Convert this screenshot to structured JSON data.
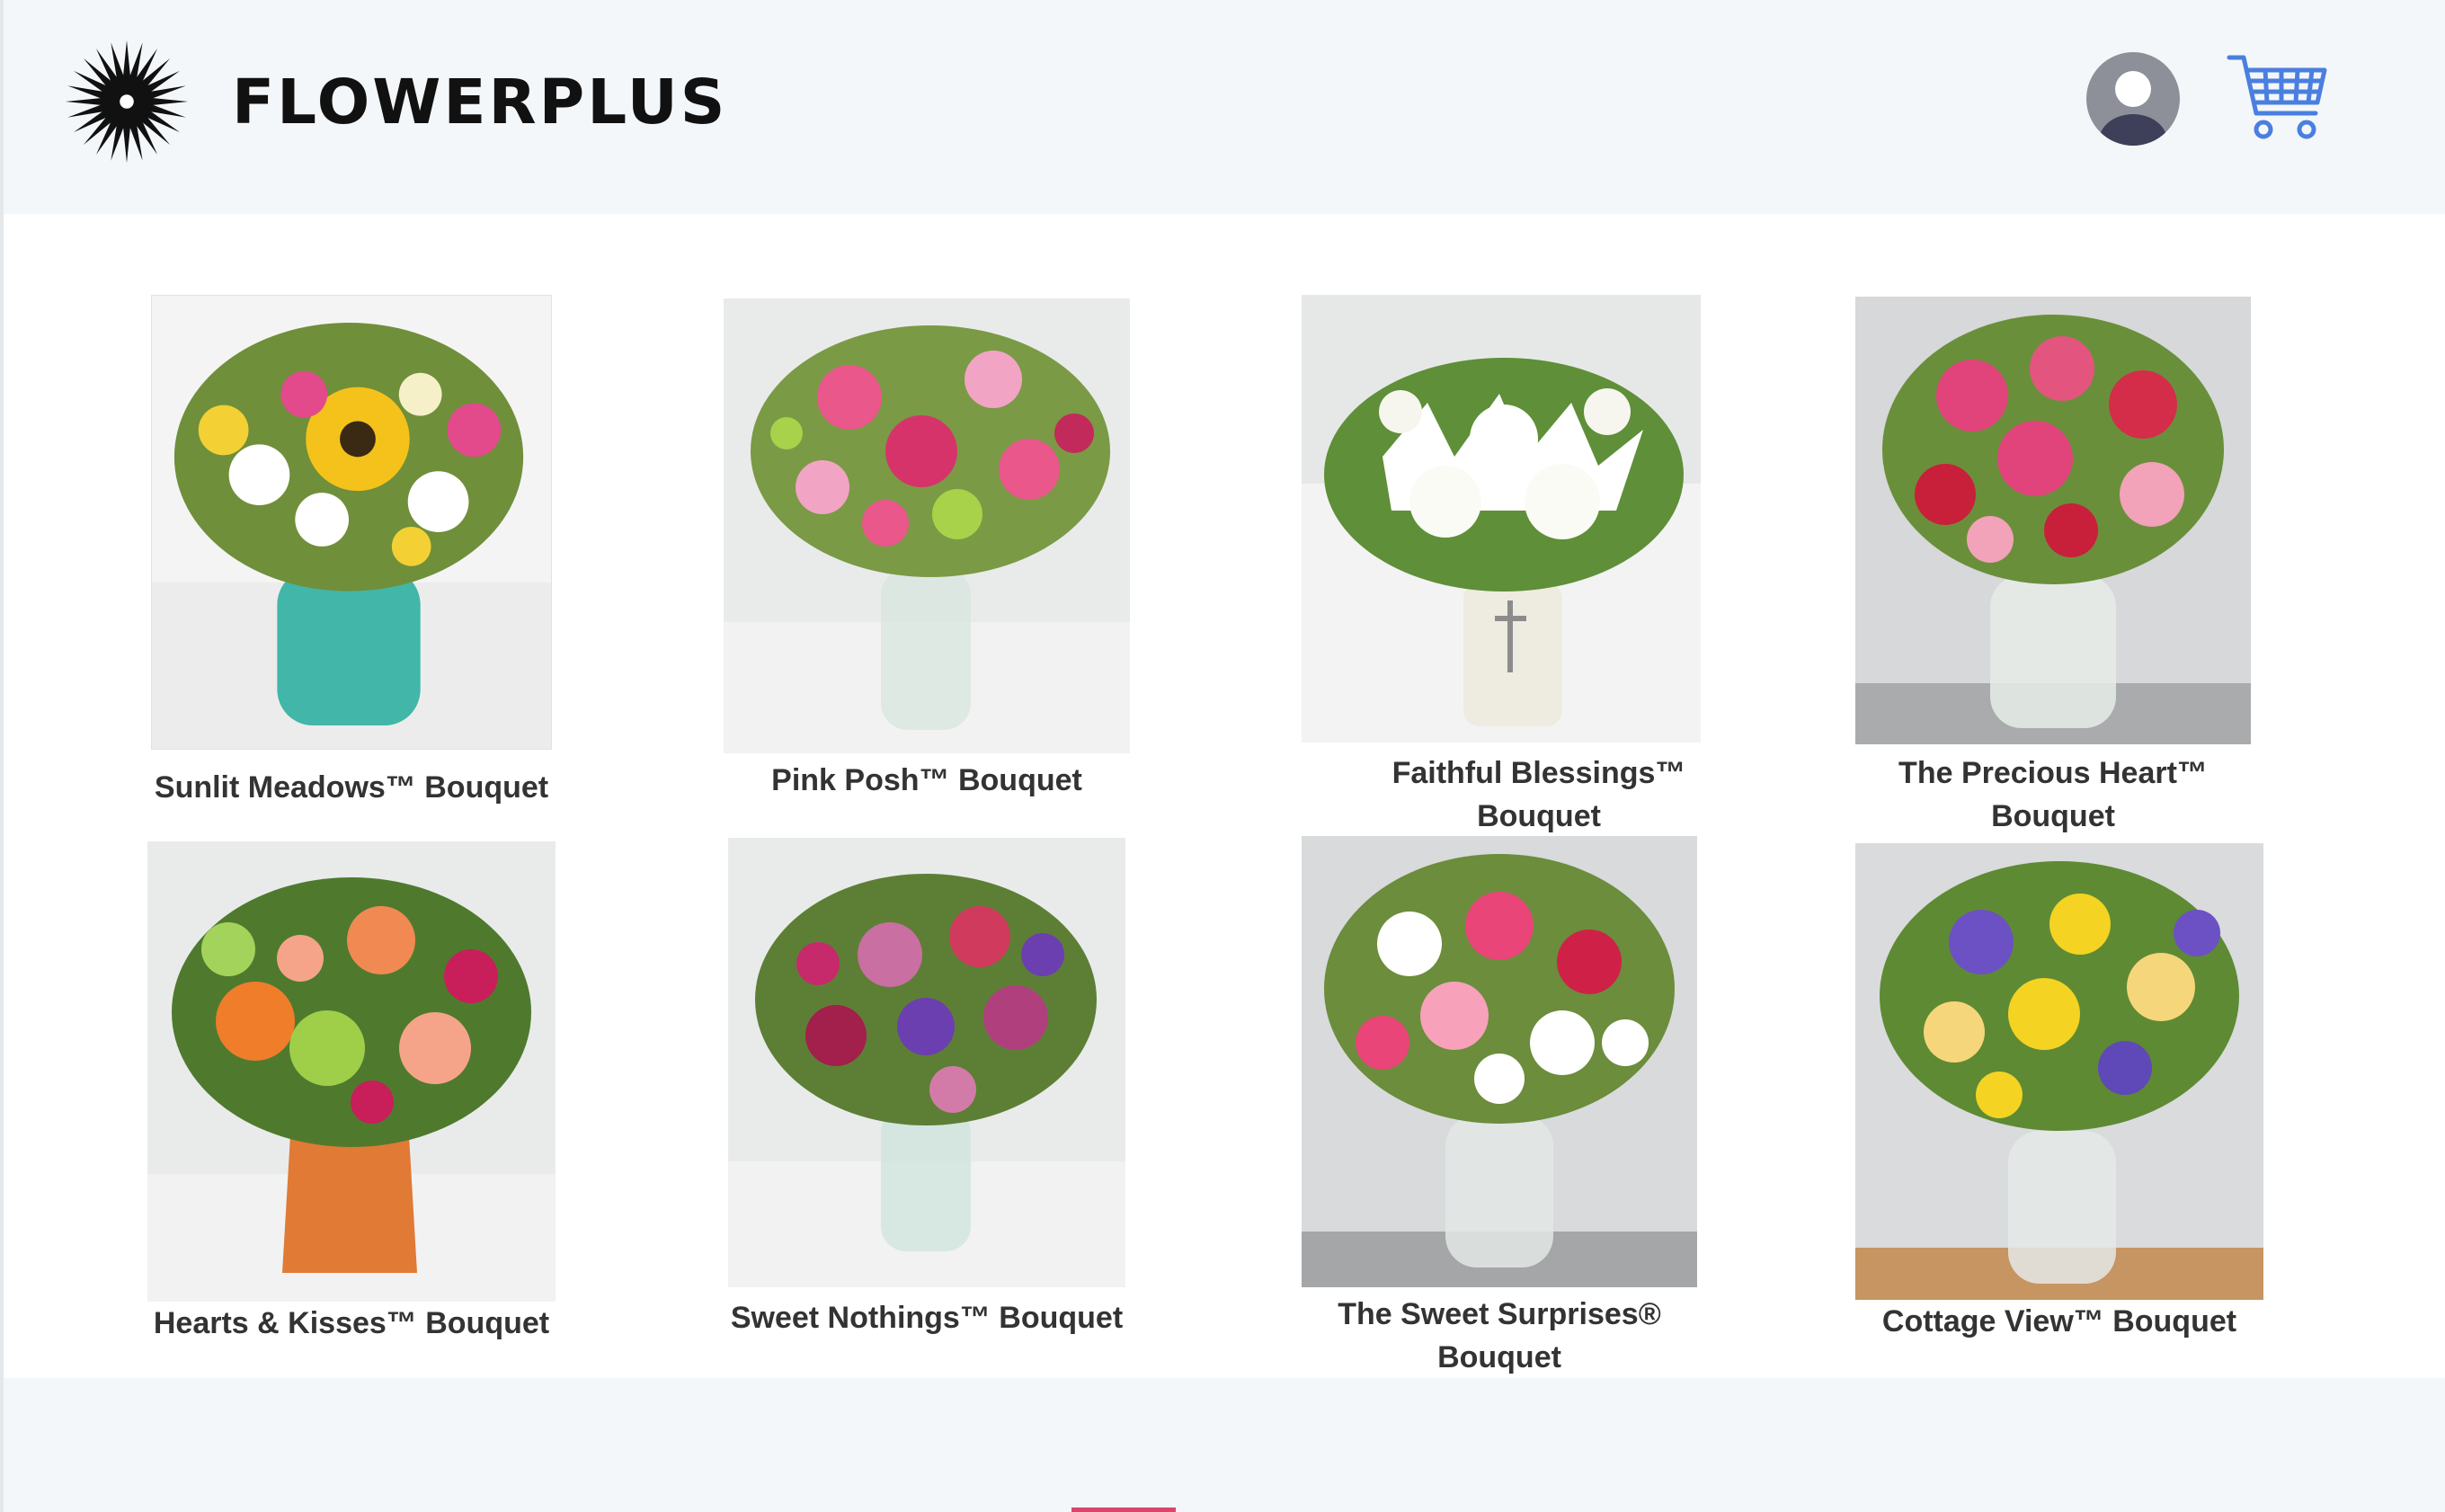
{
  "brand": {
    "name": "FLOWERPLUS"
  },
  "header": {
    "account_icon": "user-avatar-icon",
    "cart_icon": "shopping-cart-icon"
  },
  "products": [
    {
      "name": "Sunlit Meadows™ Bouquet"
    },
    {
      "name": "Pink Posh™ Bouquet"
    },
    {
      "name": "Faithful Blessings™ Bouquet"
    },
    {
      "name": "The Precious Heart™ Bouquet"
    },
    {
      "name": "Hearts & Kisses™ Bouquet"
    },
    {
      "name": "Sweet Nothings™ Bouquet"
    },
    {
      "name": "The Sweet Surprises® Bouquet"
    },
    {
      "name": "Cottage View™ Bouquet"
    }
  ],
  "colors": {
    "header_bg": "#f3f7f9",
    "cart_blue": "#4a7fe0",
    "avatar_gray": "#8d8f99",
    "indicator": "#d9466a"
  }
}
